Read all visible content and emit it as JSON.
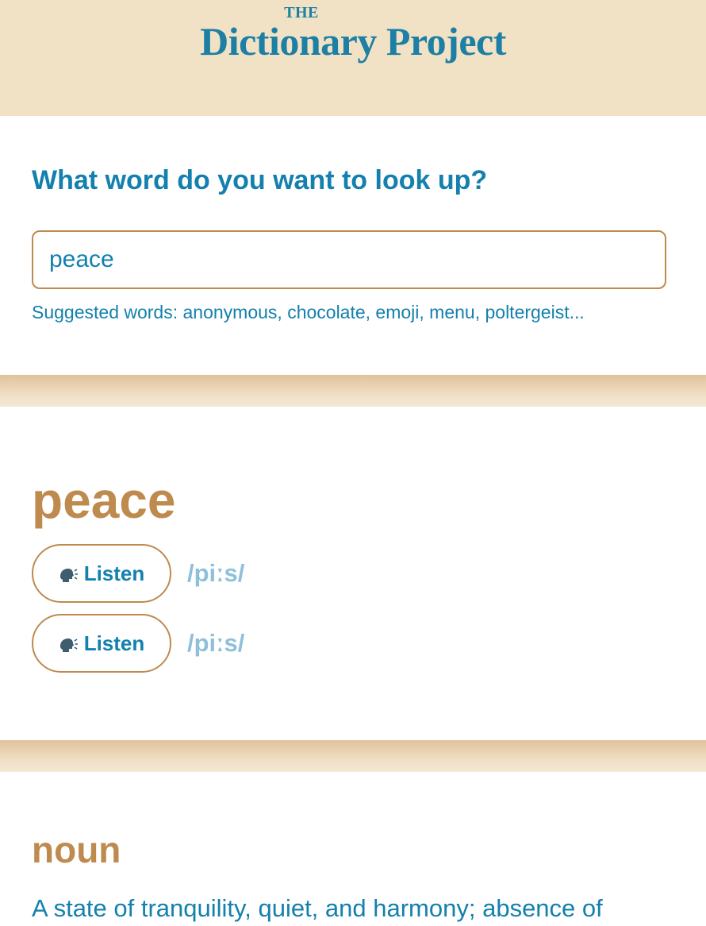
{
  "header": {
    "logo_the": "THE",
    "logo_main": "Dictionary Project"
  },
  "search": {
    "heading": "What word do you want to look up?",
    "value": "peace",
    "suggested": "Suggested words: anonymous, chocolate, emoji, menu, poltergeist..."
  },
  "entry": {
    "word": "peace",
    "pronunciations": [
      {
        "button_label": "Listen",
        "icon": "speaking-head-icon",
        "phonetic": "/piːs/"
      },
      {
        "button_label": "Listen",
        "icon": "speaking-head-icon",
        "phonetic": "/piːs/"
      }
    ],
    "part_of_speech": "noun",
    "definition": "A state of tranquility, quiet, and harmony; absence of"
  },
  "colors": {
    "header_bg": "#f1e2c6",
    "primary_blue": "#1380ad",
    "accent_tan": "#bf8a4e",
    "phonetic_blue": "#8fc0d9"
  }
}
